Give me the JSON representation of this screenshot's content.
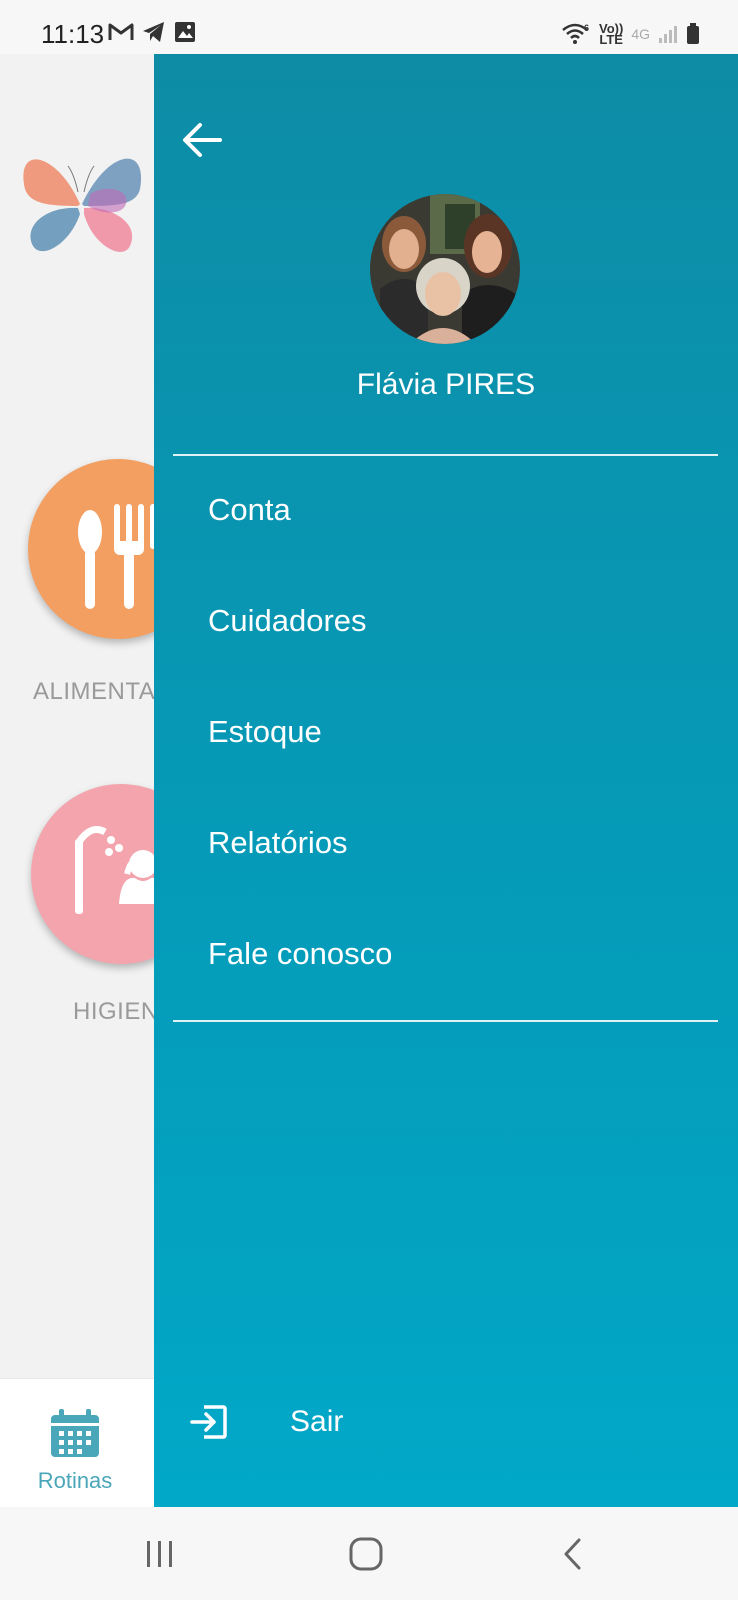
{
  "status_bar": {
    "time": "11:13",
    "left_icons": [
      "gmail-icon",
      "telegram-icon",
      "gallery-icon"
    ],
    "right_icons": [
      "wifi-6-icon",
      "volte-icon",
      "signal-icon",
      "battery-icon"
    ],
    "volte_top": "Vo))",
    "volte_bottom": "LTE",
    "network_label": "4G"
  },
  "background_app": {
    "categories": [
      {
        "label": "ALIMENTA",
        "color": "#f29f61",
        "icon": "cutlery-icon"
      },
      {
        "label": "HIGIEN",
        "color": "#f3a4ad",
        "icon": "shower-icon"
      }
    ],
    "bottom_nav": {
      "rotinas_label": "Rotinas",
      "accent": "#4aa6b9"
    }
  },
  "drawer": {
    "user_name": "Flávia PIRES",
    "menu_items": [
      {
        "label": "Conta"
      },
      {
        "label": "Cuidadores"
      },
      {
        "label": "Estoque"
      },
      {
        "label": "Relatórios"
      },
      {
        "label": "Fale conosco"
      }
    ],
    "logout_label": "Sair",
    "colors": {
      "top": "#0e8ca6",
      "bottom": "#02a8c8"
    }
  }
}
